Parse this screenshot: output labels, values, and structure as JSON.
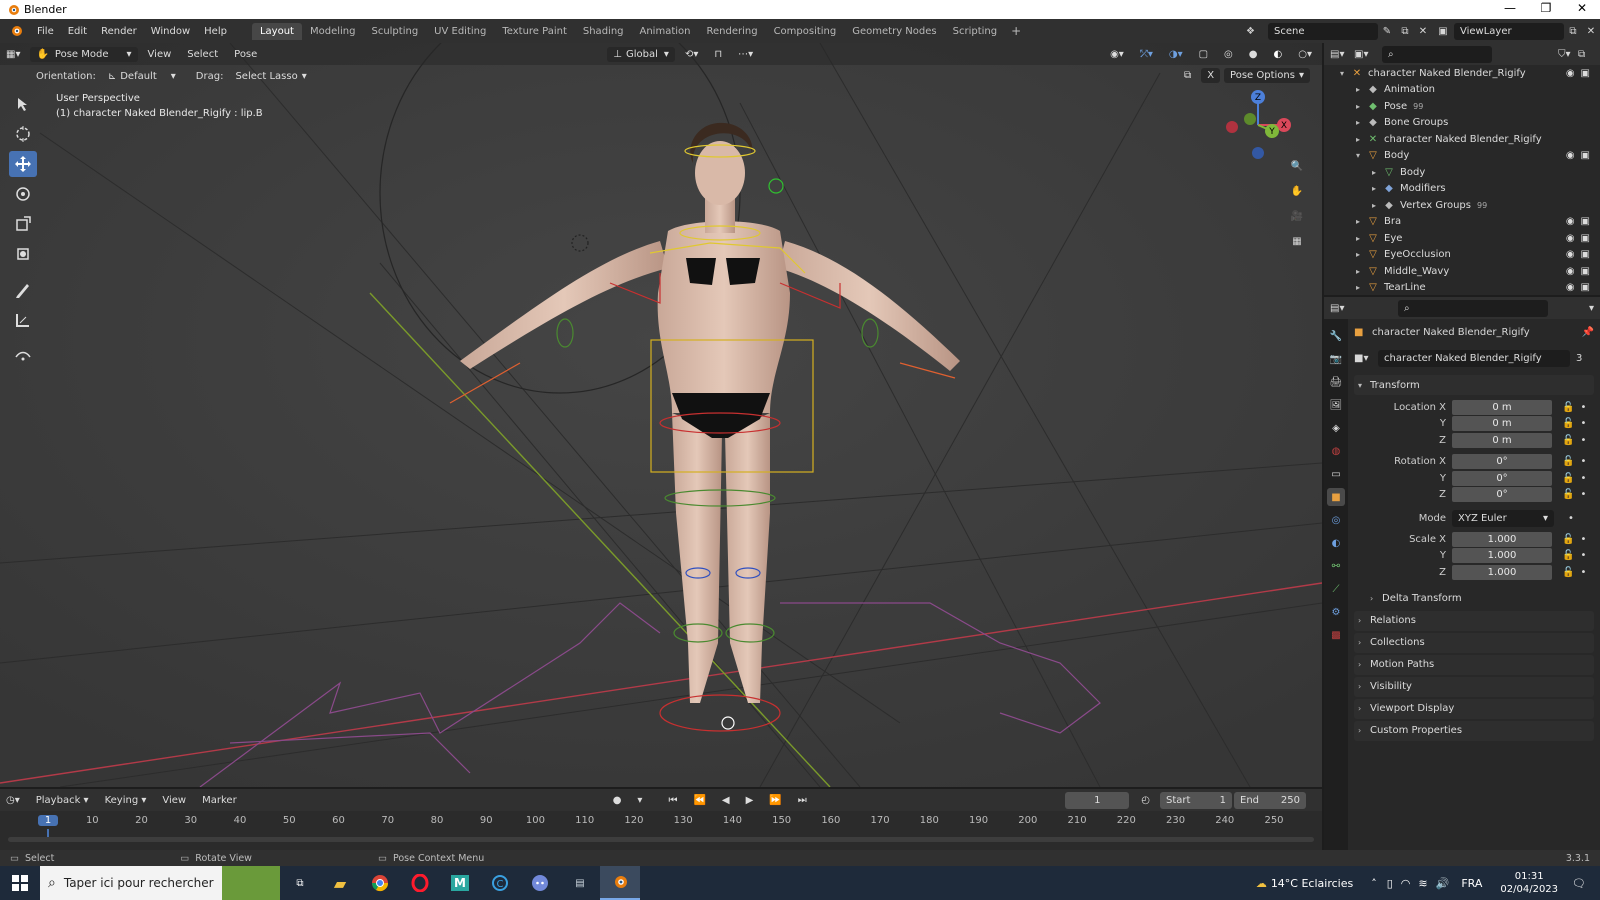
{
  "window": {
    "title": "Blender",
    "controls": [
      "—",
      "❐",
      "✕"
    ]
  },
  "menus": [
    "File",
    "Edit",
    "Render",
    "Window",
    "Help"
  ],
  "workspaces": [
    "Layout",
    "Modeling",
    "Sculpting",
    "UV Editing",
    "Texture Paint",
    "Shading",
    "Animation",
    "Rendering",
    "Compositing",
    "Geometry Nodes",
    "Scripting"
  ],
  "active_workspace": "Layout",
  "scene": {
    "name": "Scene",
    "view_layer": "ViewLayer"
  },
  "viewport": {
    "mode": "Pose Mode",
    "header_menus": [
      "View",
      "Select",
      "Pose"
    ],
    "transform_orientation": "Global",
    "orientation_label": "Orientation:",
    "orientation_value": "Default",
    "drag_label": "Drag:",
    "drag_value": "Select Lasso",
    "pose_options": "Pose Options",
    "info_line1": "User Perspective",
    "info_line2": "(1) character Naked Blender_Rigify : lip.B",
    "gizmo": {
      "x": "X",
      "y": "Y",
      "z": "Z"
    }
  },
  "outliner": {
    "items": [
      {
        "label": "character Naked Blender_Rigify",
        "indent": 0,
        "expanded": true,
        "icon": "armature-icon",
        "color": "#e8a040",
        "visible": true
      },
      {
        "label": "Animation",
        "indent": 1,
        "expanded": false,
        "icon": "animation-icon",
        "color": "#bbbbbb"
      },
      {
        "label": "Pose",
        "indent": 1,
        "expanded": false,
        "icon": "pose-icon",
        "color": "#6fbf6f",
        "badge": "99"
      },
      {
        "label": "Bone Groups",
        "indent": 1,
        "expanded": false,
        "icon": "bone-groups-icon",
        "color": "#bbbbbb"
      },
      {
        "label": "character Naked Blender_Rigify",
        "indent": 1,
        "expanded": false,
        "icon": "armature-data-icon",
        "color": "#6fbf6f"
      },
      {
        "label": "Body",
        "indent": 1,
        "expanded": true,
        "icon": "mesh-object-icon",
        "color": "#e8a040",
        "visible": true
      },
      {
        "label": "Body",
        "indent": 2,
        "expanded": false,
        "icon": "mesh-data-icon",
        "color": "#6fbf6f"
      },
      {
        "label": "Modifiers",
        "indent": 2,
        "expanded": false,
        "icon": "modifier-icon",
        "color": "#7fa3d8"
      },
      {
        "label": "Vertex Groups",
        "indent": 2,
        "expanded": false,
        "icon": "vertex-groups-icon",
        "color": "#bbbbbb",
        "badge": "99"
      },
      {
        "label": "Bra",
        "indent": 1,
        "expanded": false,
        "icon": "mesh-object-icon",
        "color": "#e8a040",
        "visible": true
      },
      {
        "label": "Eye",
        "indent": 1,
        "expanded": false,
        "icon": "mesh-object-icon",
        "color": "#e8a040",
        "visible": true
      },
      {
        "label": "EyeOcclusion",
        "indent": 1,
        "expanded": false,
        "icon": "mesh-object-icon",
        "color": "#e8a040",
        "visible": true
      },
      {
        "label": "Middle_Wavy",
        "indent": 1,
        "expanded": false,
        "icon": "mesh-object-icon",
        "color": "#e8a040",
        "visible": true
      },
      {
        "label": "TearLine",
        "indent": 1,
        "expanded": false,
        "icon": "mesh-object-icon",
        "color": "#e8a040",
        "visible": true
      }
    ]
  },
  "properties": {
    "object_name": "character Naked Blender_Rigify",
    "datablock_name": "character Naked Blender_Rigify",
    "datablock_users": "3",
    "transform_label": "Transform",
    "location": {
      "label": "Location X",
      "x": "0 m",
      "y": "0 m",
      "z": "0 m"
    },
    "rotation": {
      "label": "Rotation X",
      "x": "0°",
      "y": "0°",
      "z": "0°"
    },
    "mode_label": "Mode",
    "mode_value": "XYZ Euler",
    "scale": {
      "label": "Scale X",
      "x": "1.000",
      "y": "1.000",
      "z": "1.000"
    },
    "axis_y": "Y",
    "axis_z": "Z",
    "delta_transform": "Delta Transform",
    "panels": [
      "Relations",
      "Collections",
      "Motion Paths",
      "Visibility",
      "Viewport Display",
      "Custom Properties"
    ]
  },
  "timeline": {
    "menus": [
      "Playback",
      "Keying",
      "View",
      "Marker"
    ],
    "current_frame": "1",
    "start_label": "Start",
    "start_value": "1",
    "end_label": "End",
    "end_value": "250",
    "ruler": [
      "1",
      "10",
      "20",
      "30",
      "40",
      "50",
      "60",
      "70",
      "80",
      "90",
      "100",
      "110",
      "120",
      "130",
      "140",
      "150",
      "160",
      "170",
      "180",
      "190",
      "200",
      "210",
      "220",
      "230",
      "240",
      "250"
    ]
  },
  "statusbar": {
    "select": "Select",
    "rotate": "Rotate View",
    "context": "Pose Context Menu",
    "version": "3.3.1"
  },
  "taskbar": {
    "search_placeholder": "Taper ici pour rechercher",
    "weather": "14°C  Eclaircies",
    "language": "FRA",
    "time": "01:31",
    "date": "02/04/2023"
  }
}
